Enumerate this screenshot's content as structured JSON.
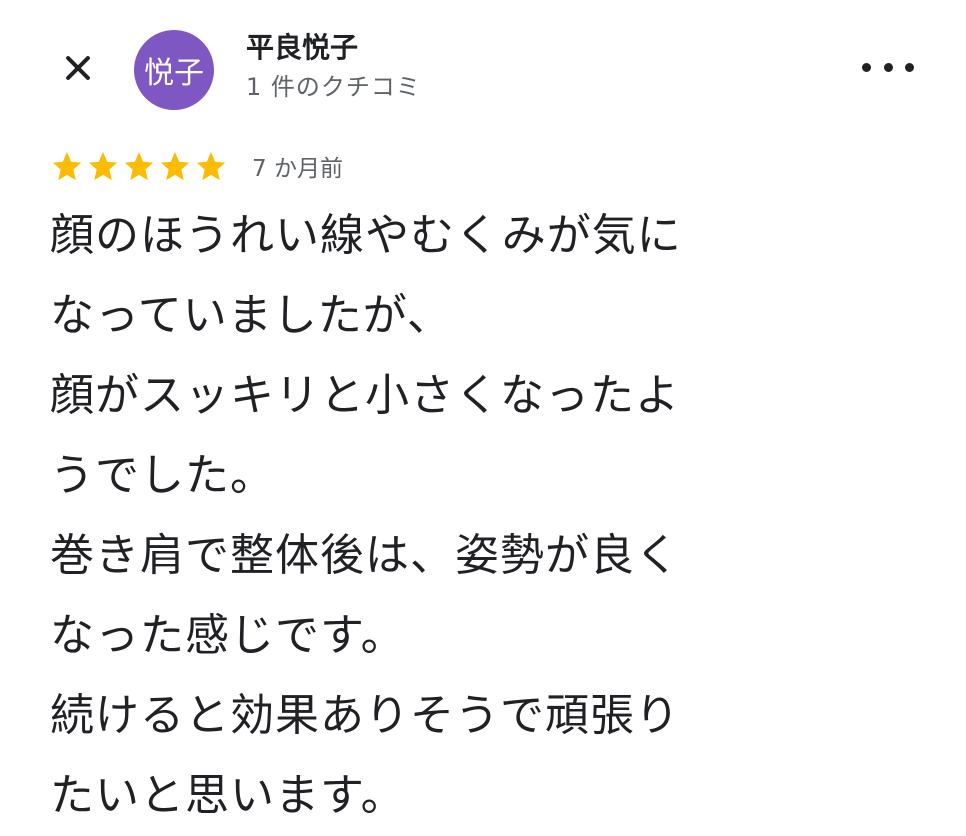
{
  "header": {
    "close_icon": "close-icon",
    "avatar_initials": "悦子",
    "avatar_color": "#7e57c2",
    "reviewer_name": "平良悦子",
    "review_count": "1 件のクチコミ",
    "more_icon": "more-horizontal-icon"
  },
  "review": {
    "rating": 5,
    "rating_max": 5,
    "star_color": "#fbbc04",
    "date": "7 か月前",
    "text": "顔のほうれい線やむくみが気に\nなっていましたが、\n顔がスッキリと小さくなったよ\nうでした。\n巻き肩で整体後は、姿勢が良く\nなった感じです。\n続けると効果ありそうで頑張り\nたいと思います。"
  }
}
